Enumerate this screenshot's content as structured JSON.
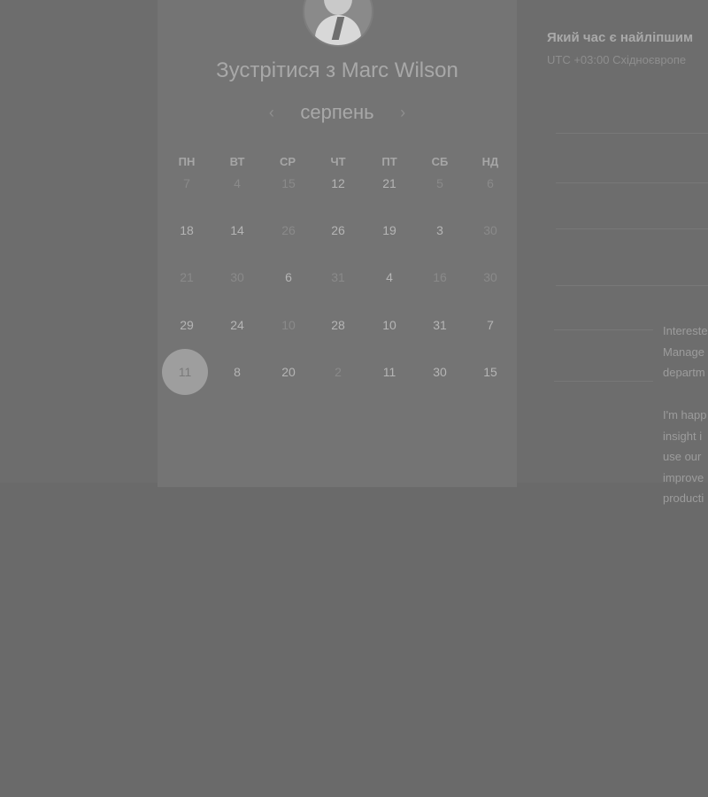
{
  "booking": {
    "title": "Зустрітися з Marc Wilson",
    "month": "серпень",
    "prev_label": "‹",
    "next_label": "›",
    "weekdays": [
      "ПН",
      "ВТ",
      "СР",
      "ЧТ",
      "ПТ",
      "СБ",
      "НД"
    ],
    "weeks": [
      [
        "7",
        "4",
        "15",
        "12",
        "21",
        "5",
        "6"
      ],
      [
        "18",
        "14",
        "26",
        "26",
        "19",
        "3",
        "30"
      ],
      [
        "21",
        "30",
        "6",
        "31",
        "4",
        "16",
        "30"
      ],
      [
        "29",
        "24",
        "10",
        "28",
        "10",
        "31",
        "7"
      ],
      [
        "11",
        "8",
        "20",
        "2",
        "11",
        "30",
        "15"
      ]
    ],
    "selected_day": "11"
  },
  "times": {
    "question": "Який час є найліпшим",
    "timezone": "UTC +03:00 Східноєвропе"
  },
  "notes": {
    "block1": [
      "Intereste",
      "Manage",
      "departm"
    ],
    "block2": [
      "I'm happ",
      "insight i",
      "use our",
      "improve",
      "producti"
    ]
  },
  "colors": {
    "overlay": "#6a6a6a",
    "card": "#747474",
    "selected": "#9e9e9e"
  }
}
